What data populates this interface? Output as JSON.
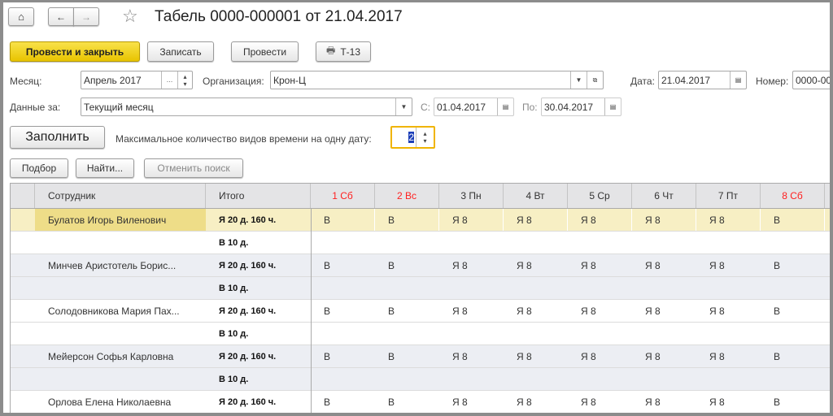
{
  "title": "Табель 0000-000001 от 21.04.2017",
  "toolbar": {
    "post_close": "Провести и закрыть",
    "save": "Записать",
    "post": "Провести",
    "print": "Т-13"
  },
  "fields": {
    "month_label": "Месяц:",
    "month_value": "Апрель 2017",
    "org_label": "Организация:",
    "org_value": "Крон-Ц",
    "date_label": "Дата:",
    "date_value": "21.04.2017",
    "number_label": "Номер:",
    "number_value": "0000-00",
    "data_for_label": "Данные за:",
    "data_for_value": "Текущий месяц",
    "from_label": "С:",
    "from_value": "01.04.2017",
    "to_label": "По:",
    "to_value": "30.04.2017",
    "fill": "Заполнить",
    "max_label": "Максимальное количество видов времени на одну дату:",
    "max_value": "2"
  },
  "table_buttons": {
    "select": "Подбор",
    "find": "Найти...",
    "cancel_search": "Отменить поиск"
  },
  "table": {
    "headers": {
      "employee": "Сотрудник",
      "total": "Итого"
    },
    "days": [
      {
        "label": "1 Сб",
        "weekend": true
      },
      {
        "label": "2 Вс",
        "weekend": true
      },
      {
        "label": "3 Пн",
        "weekend": false
      },
      {
        "label": "4 Вт",
        "weekend": false
      },
      {
        "label": "5 Ср",
        "weekend": false
      },
      {
        "label": "6 Чт",
        "weekend": false
      },
      {
        "label": "7 Пт",
        "weekend": false
      },
      {
        "label": "8 Сб",
        "weekend": true
      }
    ],
    "rows": [
      {
        "name": "Булатов Игорь Виленович",
        "total1": "Я 20 д. 160 ч.",
        "total2": "В 10 д.",
        "days": [
          "В",
          "В",
          "Я 8",
          "Я 8",
          "Я 8",
          "Я 8",
          "Я 8",
          "В"
        ],
        "selected": true
      },
      {
        "name": "Минчев Аристотель Борис...",
        "total1": "Я 20 д. 160 ч.",
        "total2": "В 10 д.",
        "days": [
          "В",
          "В",
          "Я 8",
          "Я 8",
          "Я 8",
          "Я 8",
          "Я 8",
          "В"
        ]
      },
      {
        "name": "Солодовникова Мария Пах...",
        "total1": "Я 20 д. 160 ч.",
        "total2": "В 10 д.",
        "days": [
          "В",
          "В",
          "Я 8",
          "Я 8",
          "Я 8",
          "Я 8",
          "Я 8",
          "В"
        ]
      },
      {
        "name": "Мейерсон Софья Карловна",
        "total1": "Я 20 д. 160 ч.",
        "total2": "В 10 д.",
        "days": [
          "В",
          "В",
          "Я 8",
          "Я 8",
          "Я 8",
          "Я 8",
          "Я 8",
          "В"
        ]
      },
      {
        "name": "Орлова Елена Николаевна",
        "total1": "Я 20 д. 160 ч.",
        "total2": "",
        "days": [
          "В",
          "В",
          "Я 8",
          "Я 8",
          "Я 8",
          "Я 8",
          "Я 8",
          "В"
        ]
      }
    ]
  },
  "colors": {
    "weekend": "#ff2020",
    "selected_row": "#f7efc4",
    "selected_name": "#eedd88",
    "alt_row": "#eceef3",
    "accent": "#f0c000"
  }
}
